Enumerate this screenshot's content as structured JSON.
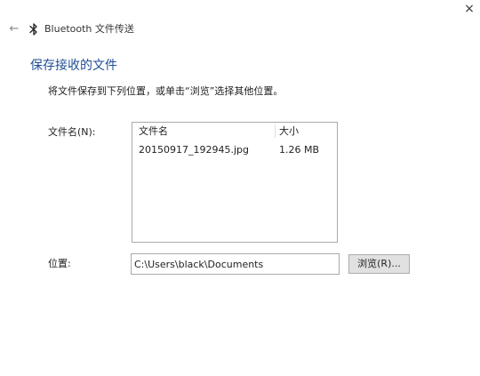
{
  "window": {
    "title": "Bluetooth 文件传送",
    "close_glyph": "×",
    "back_glyph": "←"
  },
  "icons": {
    "back": "back-arrow-icon",
    "bluetooth": "bluetooth-icon",
    "close": "close-icon"
  },
  "page": {
    "title": "保存接收的文件",
    "instruction": "将文件保存到下列位置，或单击“浏览”选择其他位置。"
  },
  "file_section": {
    "label": "文件名(N):",
    "columns": [
      "文件名",
      "大小"
    ],
    "rows": [
      {
        "name": "20150917_192945.jpg",
        "size": "1.26 MB"
      }
    ]
  },
  "location": {
    "label": "位置:",
    "value": "C:\\Users\\black\\Documents",
    "browse_label": "浏览(R)..."
  },
  "colors": {
    "title_blue": "#1f4e96",
    "border_gray": "#a9a9a9",
    "button_bg": "#e1e1e1"
  }
}
